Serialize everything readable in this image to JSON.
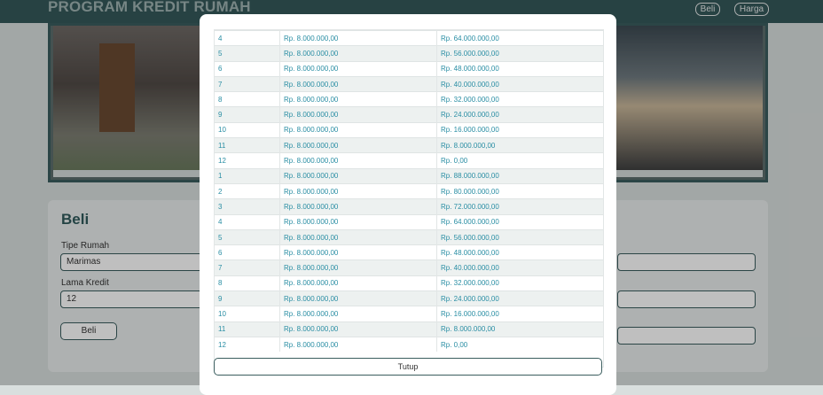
{
  "header": {
    "title": "PROGRAM KREDIT RUMAH",
    "nav": {
      "beli_label": "Beli",
      "harga_label": "Harga"
    }
  },
  "form": {
    "heading": "Beli",
    "tipe_rumah_label": "Tipe Rumah",
    "tipe_rumah_value": "Marimas",
    "lama_kredit_label": "Lama Kredit",
    "lama_kredit_value": "12",
    "submit_label": "Beli"
  },
  "modal": {
    "close_label": "Tutup",
    "rows": [
      [
        "4",
        "Rp. 8.000.000,00",
        "Rp. 64.000.000,00"
      ],
      [
        "5",
        "Rp. 8.000.000,00",
        "Rp. 56.000.000,00"
      ],
      [
        "6",
        "Rp. 8.000.000,00",
        "Rp. 48.000.000,00"
      ],
      [
        "7",
        "Rp. 8.000.000,00",
        "Rp. 40.000.000,00"
      ],
      [
        "8",
        "Rp. 8.000.000,00",
        "Rp. 32.000.000,00"
      ],
      [
        "9",
        "Rp. 8.000.000,00",
        "Rp. 24.000.000,00"
      ],
      [
        "10",
        "Rp. 8.000.000,00",
        "Rp. 16.000.000,00"
      ],
      [
        "11",
        "Rp. 8.000.000,00",
        "Rp. 8.000.000,00"
      ],
      [
        "12",
        "Rp. 8.000.000,00",
        "Rp. 0,00"
      ],
      [
        "1",
        "Rp. 8.000.000,00",
        "Rp. 88.000.000,00"
      ],
      [
        "2",
        "Rp. 8.000.000,00",
        "Rp. 80.000.000,00"
      ],
      [
        "3",
        "Rp. 8.000.000,00",
        "Rp. 72.000.000,00"
      ],
      [
        "4",
        "Rp. 8.000.000,00",
        "Rp. 64.000.000,00"
      ],
      [
        "5",
        "Rp. 8.000.000,00",
        "Rp. 56.000.000,00"
      ],
      [
        "6",
        "Rp. 8.000.000,00",
        "Rp. 48.000.000,00"
      ],
      [
        "7",
        "Rp. 8.000.000,00",
        "Rp. 40.000.000,00"
      ],
      [
        "8",
        "Rp. 8.000.000,00",
        "Rp. 32.000.000,00"
      ],
      [
        "9",
        "Rp. 8.000.000,00",
        "Rp. 24.000.000,00"
      ],
      [
        "10",
        "Rp. 8.000.000,00",
        "Rp. 16.000.000,00"
      ],
      [
        "11",
        "Rp. 8.000.000,00",
        "Rp. 8.000.000,00"
      ],
      [
        "12",
        "Rp. 8.000.000,00",
        "Rp. 0,00"
      ]
    ]
  },
  "colors": {
    "header_bg": "#35585a",
    "accent_teal": "#2a8ea4",
    "border_teal": "#3a5d5e"
  }
}
